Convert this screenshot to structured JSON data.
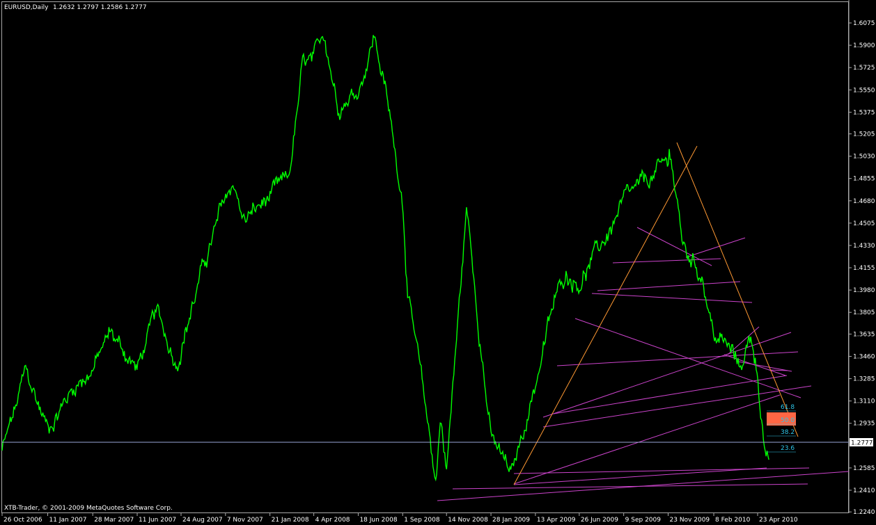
{
  "header": {
    "symbol": "EURUSD,Daily",
    "ohlc": "1.2632 1.2797 1.2586 1.2777"
  },
  "footer": {
    "copyright": "XTB-Trader, © 2001-2009 MetaQuotes Software Corp."
  },
  "colors": {
    "background": "#000000",
    "candles": "#00ff00",
    "trend_fan": "#cc44cc",
    "trend_orange": "#ff9933",
    "fib_text": "#2ec4e6",
    "fib_zone": "#ff6644",
    "axis": "#ffffff"
  },
  "chart_data": {
    "type": "line",
    "symbol": "EURUSD",
    "timeframe": "Daily",
    "last_ohlc": {
      "open": 1.2632,
      "high": 1.2797,
      "low": 1.2586,
      "close": 1.2777
    },
    "current_price": 1.2777,
    "y_ticks": [
      "1.6075",
      "1.5900",
      "1.5725",
      "1.5550",
      "1.5375",
      "1.5205",
      "1.5030",
      "1.4855",
      "1.4680",
      "1.4505",
      "1.4330",
      "1.4155",
      "1.3980",
      "1.3805",
      "1.3635",
      "1.3460",
      "1.3285",
      "1.3110",
      "1.2935",
      "1.2777",
      "1.2585",
      "1.2410",
      "1.2240"
    ],
    "x_ticks": [
      "26 Oct 2006",
      "11 Jan 2007",
      "28 Mar 2007",
      "11 Jun 2007",
      "24 Aug 2007",
      "7 Nov 2007",
      "21 Jan 2008",
      "4 Apr 2008",
      "18 Jun 2008",
      "1 Sep 2008",
      "14 Nov 2008",
      "28 Jan 2009",
      "13 Apr 2009",
      "26 Jun 2009",
      "9 Sep 2009",
      "23 Nov 2009",
      "8 Feb 2010",
      "23 Apr 2010"
    ],
    "ylim": [
      1.224,
      1.614
    ],
    "series": [
      {
        "x": [
          "26 Oct 2006",
          "20 Nov 2006",
          "4 Dec 2006",
          "11 Jan 2007",
          "28 Feb 2007",
          "28 Mar 2007",
          "27 Apr 2007",
          "11 Jun 2007",
          "13 Jul 2007",
          "16 Aug 2007",
          "24 Aug 2007",
          "28 Sep 2007",
          "7 Nov 2007",
          "23 Nov 2007",
          "6 Dec 2007",
          "21 Jan 2008",
          "22 Feb 2008",
          "17 Mar 2008",
          "4 Apr 2008",
          "22 Apr 2008",
          "14 May 2008",
          "18 Jun 2008",
          "15 Jul 2008",
          "1 Aug 2008",
          "1 Sep 2008",
          "10 Sep 2008",
          "16 Oct 2008",
          "27 Oct 2008",
          "4 Nov 2008",
          "14 Nov 2008",
          "18 Dec 2008",
          "28 Jan 2009",
          "4 Mar 2009",
          "13 Apr 2009",
          "13 May 2009",
          "3 Jun 2009",
          "26 Jun 2009",
          "5 Aug 2009",
          "9 Sep 2009",
          "25 Nov 2009",
          "23 Nov 2009",
          "18 Dec 2009",
          "20 Jan 2010",
          "8 Feb 2010",
          "1 Mar 2010",
          "24 Mar 2010",
          "13 Apr 2010",
          "23 Apr 2010",
          "7 May 2010",
          "13 May 2010"
        ],
        "y": [
          1.272,
          1.308,
          1.334,
          1.29,
          1.325,
          1.336,
          1.365,
          1.336,
          1.38,
          1.342,
          1.355,
          1.412,
          1.47,
          1.482,
          1.452,
          1.47,
          1.485,
          1.575,
          1.575,
          1.6,
          1.545,
          1.555,
          1.598,
          1.56,
          1.47,
          1.395,
          1.285,
          1.248,
          1.3,
          1.258,
          1.462,
          1.282,
          1.252,
          1.325,
          1.385,
          1.412,
          1.405,
          1.435,
          1.466,
          1.512,
          1.498,
          1.432,
          1.41,
          1.362,
          1.355,
          1.338,
          1.362,
          1.332,
          1.265,
          1.257
        ]
      }
    ],
    "fib_levels": [
      "61.8",
      "50.0",
      "38.2",
      "23.6"
    ]
  }
}
